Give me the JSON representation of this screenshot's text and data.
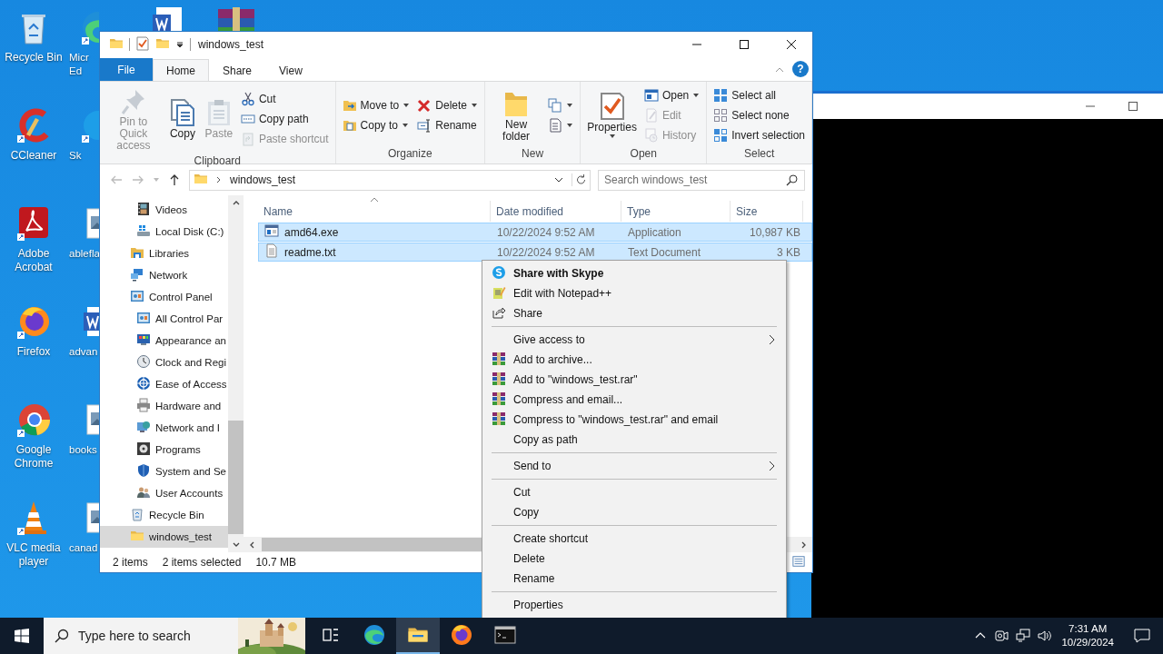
{
  "desktop": {
    "icons": [
      {
        "label": "Recycle Bin"
      },
      {
        "label": "CCleaner"
      },
      {
        "label": "Adobe Acrobat"
      },
      {
        "label": "Firefox"
      },
      {
        "label": "Google Chrome"
      },
      {
        "label": "VLC media player"
      }
    ],
    "partial_icons": [
      {
        "label": "Micr\nEd"
      },
      {
        "label": "Sk"
      },
      {
        "label": "ablefla"
      },
      {
        "label": "advan"
      },
      {
        "label": "books"
      },
      {
        "label": "canad"
      }
    ]
  },
  "explorer": {
    "title": "windows_test",
    "ribbon_tabs": [
      {
        "label": "File",
        "kind": "menu",
        "selected": false
      },
      {
        "label": "Home",
        "kind": "tab",
        "selected": true
      },
      {
        "label": "Share",
        "kind": "tab",
        "selected": false
      },
      {
        "label": "View",
        "kind": "tab",
        "selected": false
      }
    ],
    "help_label": "?",
    "ribbon_groups": [
      {
        "label": "Clipboard",
        "columns": [
          [
            {
              "label": "Pin to Quick access",
              "kind": "large",
              "disabled": true,
              "dropdown": false
            }
          ],
          [
            {
              "label": "Copy",
              "kind": "large",
              "disabled": false,
              "dropdown": false
            }
          ],
          [
            {
              "label": "Paste",
              "kind": "large",
              "disabled": true,
              "dropdown": false
            }
          ],
          [
            {
              "label": "Cut",
              "kind": "small",
              "disabled": false,
              "dropdown": false
            },
            {
              "label": "Copy path",
              "kind": "small",
              "disabled": false,
              "dropdown": false
            },
            {
              "label": "Paste shortcut",
              "kind": "small",
              "disabled": true,
              "dropdown": false
            }
          ]
        ]
      },
      {
        "label": "Organize",
        "columns": [
          [
            {
              "label": "Move to",
              "kind": "small",
              "disabled": false,
              "dropdown": true
            },
            {
              "label": "Copy to",
              "kind": "small",
              "disabled": false,
              "dropdown": true
            }
          ],
          [
            {
              "label": "Delete",
              "kind": "small",
              "disabled": false,
              "dropdown": true
            },
            {
              "label": "Rename",
              "kind": "small",
              "disabled": false,
              "dropdown": false
            }
          ]
        ]
      },
      {
        "label": "New",
        "columns": [
          [
            {
              "label": "New folder",
              "kind": "large",
              "disabled": false,
              "dropdown": false
            }
          ],
          [
            {
              "kind": "icon",
              "disabled": false,
              "dropdown": true
            },
            {
              "kind": "icon",
              "disabled": false,
              "dropdown": true
            }
          ]
        ]
      },
      {
        "label": "Open",
        "columns": [
          [
            {
              "label": "Properties",
              "kind": "large",
              "disabled": false,
              "dropdown": true
            }
          ],
          [
            {
              "label": "Open",
              "kind": "small",
              "disabled": false,
              "dropdown": true
            },
            {
              "label": "Edit",
              "kind": "small",
              "disabled": true,
              "dropdown": false
            },
            {
              "label": "History",
              "kind": "small",
              "disabled": true,
              "dropdown": false
            }
          ]
        ]
      },
      {
        "label": "Select",
        "columns": [
          [
            {
              "label": "Select all",
              "kind": "small",
              "disabled": false,
              "dropdown": false
            },
            {
              "label": "Select none",
              "kind": "small",
              "disabled": false,
              "dropdown": false
            },
            {
              "label": "Invert selection",
              "kind": "small",
              "disabled": false,
              "dropdown": false
            }
          ]
        ]
      }
    ],
    "back_disabled": true,
    "forward_disabled": true,
    "address": [
      "windows_test"
    ],
    "search_placeholder": "Search windows_test",
    "nav_pane": {
      "continued_children": [
        {
          "label": "Videos",
          "selected": false
        },
        {
          "label": "Local Disk (C:)",
          "selected": false
        }
      ],
      "items": [
        {
          "label": "Libraries",
          "selected": false
        },
        {
          "label": "Network",
          "selected": false
        },
        {
          "label": "Control Panel",
          "selected": false,
          "children": [
            {
              "label": "All Control Par",
              "selected": false
            },
            {
              "label": "Appearance an",
              "selected": false
            },
            {
              "label": "Clock and Regi",
              "selected": false
            },
            {
              "label": "Ease of Access",
              "selected": false
            },
            {
              "label": "Hardware and",
              "selected": false
            },
            {
              "label": "Network and I",
              "selected": false
            },
            {
              "label": "Programs",
              "selected": false
            },
            {
              "label": "System and Se",
              "selected": false
            },
            {
              "label": "User Accounts",
              "selected": false
            }
          ]
        },
        {
          "label": "Recycle Bin",
          "selected": false
        },
        {
          "label": "windows_test",
          "selected": true
        }
      ]
    },
    "file_list": {
      "columns": [
        {
          "label": "Name",
          "sorted": true
        },
        {
          "label": "Date modified",
          "sorted": false
        },
        {
          "label": "Type",
          "sorted": false
        },
        {
          "label": "Size",
          "sorted": false
        }
      ],
      "rows": [
        {
          "kind": "exe",
          "name": "amd64.exe",
          "date": "10/22/2024 9:52 AM",
          "type": "Application",
          "size": "10,987 KB",
          "selected": true
        },
        {
          "kind": "txt",
          "name": "readme.txt",
          "date": "10/22/2024 9:52 AM",
          "type": "Text Document",
          "size": "3 KB",
          "selected": true
        }
      ]
    },
    "status_bar": [
      "2 items",
      "2 items selected",
      "10.7 MB"
    ]
  },
  "context_menu": [
    {
      "kind": "item",
      "label": "Share with Skype",
      "bold": true,
      "submenu": false
    },
    {
      "kind": "item",
      "label": "Edit with Notepad++",
      "bold": false,
      "submenu": false
    },
    {
      "kind": "item",
      "label": "Share",
      "bold": false,
      "submenu": false
    },
    {
      "kind": "separator"
    },
    {
      "kind": "item",
      "label": "Give access to",
      "bold": false,
      "submenu": true
    },
    {
      "kind": "item",
      "label": "Add to archive...",
      "bold": false,
      "submenu": false
    },
    {
      "kind": "item",
      "label": "Add to \"windows_test.rar\"",
      "bold": false,
      "submenu": false
    },
    {
      "kind": "item",
      "label": "Compress and email...",
      "bold": false,
      "submenu": false
    },
    {
      "kind": "item",
      "label": "Compress to \"windows_test.rar\" and email",
      "bold": false,
      "submenu": false
    },
    {
      "kind": "item",
      "label": "Copy as path",
      "bold": false,
      "submenu": false
    },
    {
      "kind": "separator"
    },
    {
      "kind": "item",
      "label": "Send to",
      "bold": false,
      "submenu": true
    },
    {
      "kind": "separator"
    },
    {
      "kind": "item",
      "label": "Cut",
      "bold": false,
      "submenu": false
    },
    {
      "kind": "item",
      "label": "Copy",
      "bold": false,
      "submenu": false
    },
    {
      "kind": "separator"
    },
    {
      "kind": "item",
      "label": "Create shortcut",
      "bold": false,
      "submenu": false
    },
    {
      "kind": "item",
      "label": "Delete",
      "bold": false,
      "submenu": false
    },
    {
      "kind": "item",
      "label": "Rename",
      "bold": false,
      "submenu": false
    },
    {
      "kind": "separator"
    },
    {
      "kind": "item",
      "label": "Properties",
      "bold": false,
      "submenu": false
    }
  ],
  "taskbar": {
    "search_placeholder": "Type here to search",
    "apps": [
      {
        "selected": false
      },
      {
        "selected": false
      },
      {
        "selected": true
      },
      {
        "selected": false
      },
      {
        "selected": false
      }
    ],
    "time": "7:31 AM",
    "date": "10/29/2024"
  }
}
